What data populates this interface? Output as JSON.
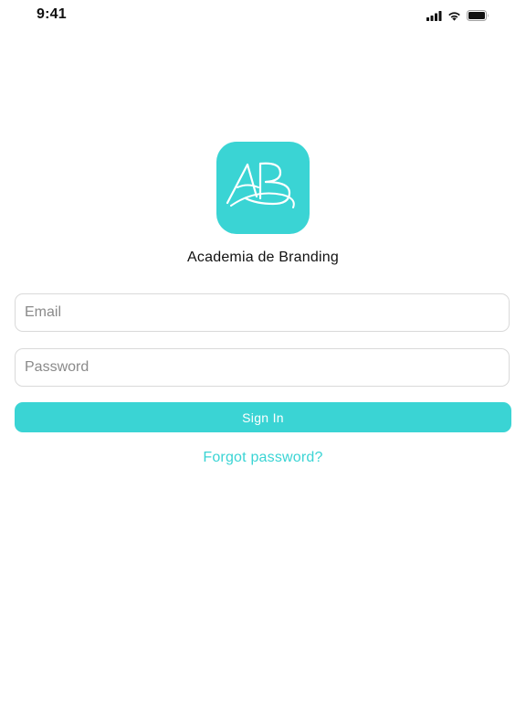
{
  "status_bar": {
    "time": "9:41",
    "icons": [
      "signal-icon",
      "wifi-icon",
      "battery-icon"
    ]
  },
  "logo": {
    "text": "AB",
    "background_color": "#3ad4d4"
  },
  "app": {
    "title": "Academia de Branding"
  },
  "form": {
    "email_placeholder": "Email",
    "email_value": "",
    "password_placeholder": "Password",
    "password_value": "",
    "sign_in_label": "Sign In",
    "forgot_password_label": "Forgot password?"
  },
  "colors": {
    "accent": "#3ad4d4",
    "field_border": "#d9d9d9",
    "text": "#111111",
    "placeholder": "#8a8a8a"
  }
}
